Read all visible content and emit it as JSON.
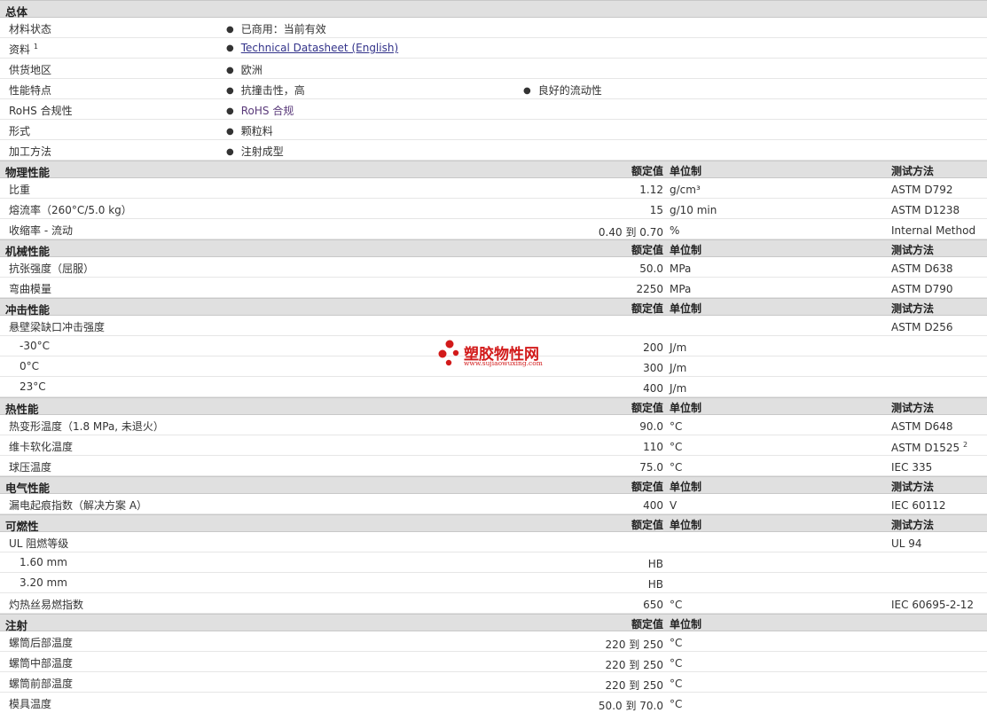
{
  "general": {
    "title": "总体",
    "rows": [
      {
        "label": "材料状态",
        "items": [
          "已商用：当前有效"
        ]
      },
      {
        "label": "资料",
        "sup": "1",
        "items": [
          "Technical Datasheet (English)"
        ]
      },
      {
        "label": "供货地区",
        "items": [
          "欧洲"
        ]
      },
      {
        "label": "性能特点",
        "items": [
          "抗撞击性，高",
          "良好的流动性"
        ]
      },
      {
        "label": "RoHS 合规性",
        "items": [
          "RoHS 合规"
        ]
      },
      {
        "label": "形式",
        "items": [
          "颗粒料"
        ]
      },
      {
        "label": "加工方法",
        "items": [
          "注射成型"
        ]
      }
    ]
  },
  "headers": {
    "value": "额定值",
    "unit": "单位制",
    "method": "测试方法"
  },
  "physical": {
    "title": "物理性能",
    "rows": [
      {
        "label": "比重",
        "value": "1.12",
        "unit": "g/cm³",
        "method": "ASTM D792"
      },
      {
        "label": "熔流率（260°C/5.0 kg）",
        "value": "15",
        "unit": "g/10 min",
        "method": "ASTM D1238"
      },
      {
        "label": "收缩率 - 流动",
        "value": "0.40 到 0.70",
        "unit": "%",
        "method": "Internal Method"
      }
    ]
  },
  "mechanical": {
    "title": "机械性能",
    "rows": [
      {
        "label": "抗张强度（屈服）",
        "value": "50.0",
        "unit": "MPa",
        "method": "ASTM D638"
      },
      {
        "label": "弯曲模量",
        "value": "2250",
        "unit": "MPa",
        "method": "ASTM D790"
      }
    ]
  },
  "impact": {
    "title": "冲击性能",
    "rows": [
      {
        "label": "悬壁梁缺口冲击强度",
        "value": "",
        "unit": "",
        "method": "ASTM D256"
      },
      {
        "label": "-30°C",
        "value": "200",
        "unit": "J/m",
        "method": ""
      },
      {
        "label": "0°C",
        "value": "300",
        "unit": "J/m",
        "method": ""
      },
      {
        "label": "23°C",
        "value": "400",
        "unit": "J/m",
        "method": ""
      }
    ]
  },
  "thermal": {
    "title": "热性能",
    "rows": [
      {
        "label": "热变形温度（1.8 MPa, 未退火）",
        "value": "90.0",
        "unit": "°C",
        "method": "ASTM D648"
      },
      {
        "label": "维卡软化温度",
        "value": "110",
        "unit": "°C",
        "method": "ASTM D1525",
        "sup": "2"
      },
      {
        "label": "球压温度",
        "value": "75.0",
        "unit": "°C",
        "method": "IEC 335"
      }
    ]
  },
  "electrical": {
    "title": "电气性能",
    "rows": [
      {
        "label": "漏电起痕指数（解决方案 A）",
        "value": "400",
        "unit": "V",
        "method": "IEC 60112"
      }
    ]
  },
  "flammability": {
    "title": "可燃性",
    "rows": [
      {
        "label": "UL 阻燃等级",
        "value": "",
        "unit": "",
        "method": "UL 94"
      },
      {
        "label": "1.60 mm",
        "value": "HB",
        "unit": "",
        "method": ""
      },
      {
        "label": "3.20 mm",
        "value": "HB",
        "unit": "",
        "method": ""
      },
      {
        "label": "灼热丝易燃指数",
        "value": "650",
        "unit": "°C",
        "method": "IEC 60695-2-12"
      }
    ]
  },
  "injection": {
    "title": "注射",
    "rows": [
      {
        "label": "螺筒后部温度",
        "value": "220 到 250",
        "unit": "°C"
      },
      {
        "label": "螺筒中部温度",
        "value": "220 到 250",
        "unit": "°C"
      },
      {
        "label": "螺筒前部温度",
        "value": "220 到 250",
        "unit": "°C"
      },
      {
        "label": "模具温度",
        "value": "50.0 到 70.0",
        "unit": "°C"
      }
    ]
  },
  "watermark": {
    "name": "塑胶物性网",
    "url": "www.sujiaowuxing.com",
    "color": "#d21a1a"
  }
}
